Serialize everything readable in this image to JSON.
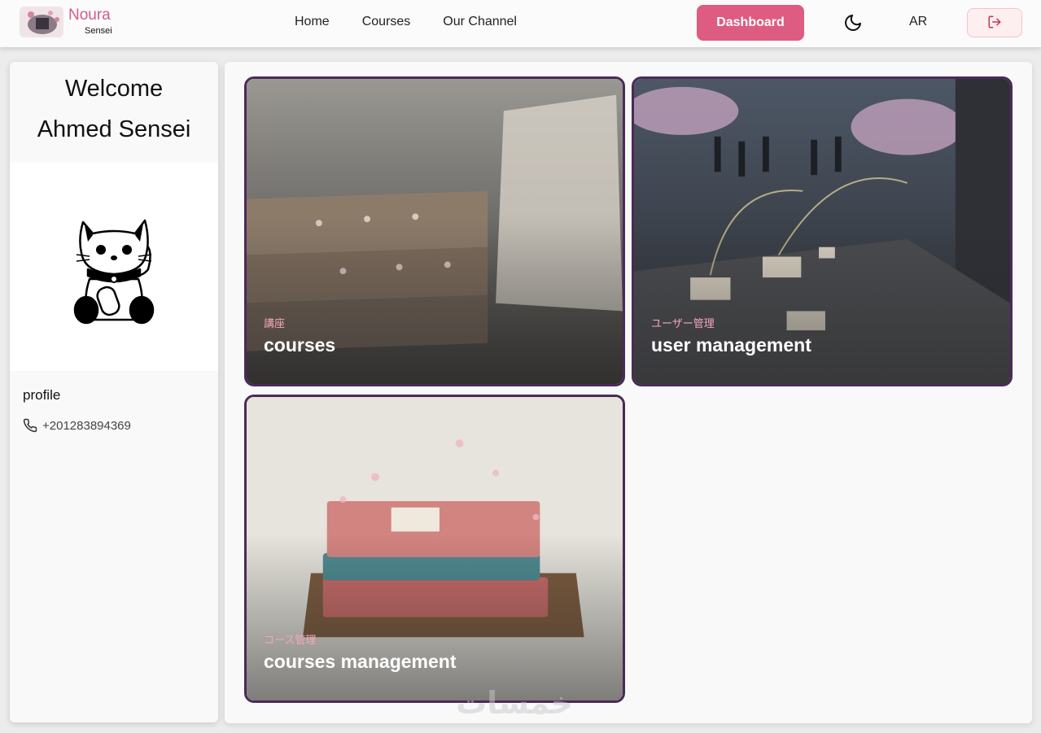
{
  "brand": {
    "name": "Noura",
    "subtitle": "Sensei"
  },
  "nav": {
    "home": "Home",
    "courses": "Courses",
    "channel": "Our Channel"
  },
  "header": {
    "dashboard_label": "Dashboard",
    "lang_label": "AR"
  },
  "sidebar": {
    "welcome_line1": "Welcome",
    "welcome_line2": "Ahmed Sensei",
    "profile_label": "profile",
    "phone": "+201283894369"
  },
  "cards": [
    {
      "jp": "講座",
      "title": "courses"
    },
    {
      "jp": "ユーザー管理",
      "title": "user management"
    },
    {
      "jp": "コース管理",
      "title": "courses management"
    }
  ],
  "watermark": "خمسات",
  "colors": {
    "accent": "#de5c81",
    "card_border": "#4a2a5a",
    "brand_text": "#d45c82"
  }
}
